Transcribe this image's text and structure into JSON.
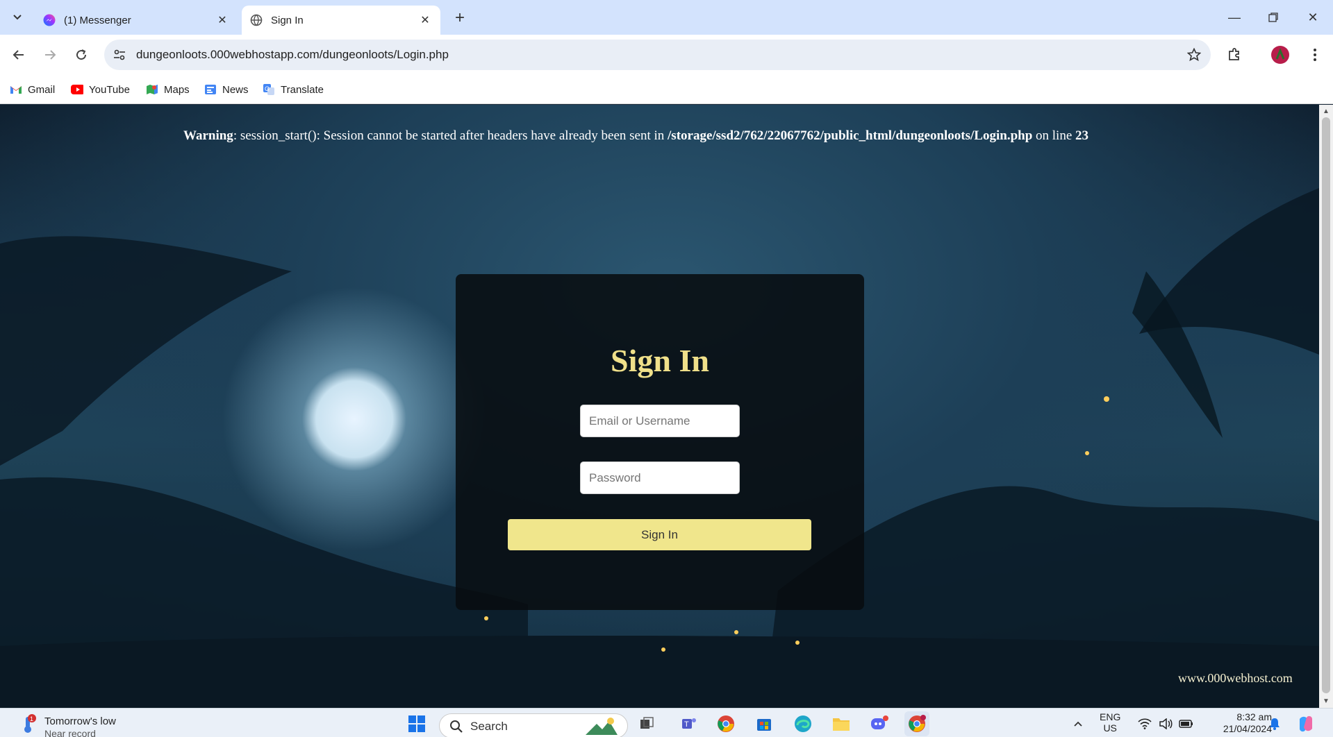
{
  "browser": {
    "tabs": [
      {
        "title": "(1) Messenger",
        "icon": "messenger-icon"
      },
      {
        "title": "Sign In",
        "icon": "globe-icon"
      }
    ],
    "url": "dungeonloots.000webhostapp.com/dungeonloots/Login.php"
  },
  "bookmarks": [
    {
      "label": "Gmail",
      "icon": "gmail-icon"
    },
    {
      "label": "YouTube",
      "icon": "youtube-icon"
    },
    {
      "label": "Maps",
      "icon": "maps-icon"
    },
    {
      "label": "News",
      "icon": "news-icon"
    },
    {
      "label": "Translate",
      "icon": "translate-icon"
    }
  ],
  "page": {
    "warning": {
      "prefix": "Warning",
      "message": ": session_start(): Session cannot be started after headers have already been sent in ",
      "path": "/storage/ssd2/762/22067762/public_html/dungeonloots/Login.php",
      "on_line": " on line ",
      "line": "23"
    },
    "login": {
      "title": "Sign In",
      "email_placeholder": "Email or Username",
      "password_placeholder": "Password",
      "button": "Sign In"
    },
    "watermark": "www.000webhost.com"
  },
  "taskbar": {
    "weather_title": "Tomorrow's low",
    "weather_sub": "Near record",
    "weather_badge": "1",
    "search": "Search",
    "lang": "ENG",
    "region": "US",
    "time": "8:32 am",
    "date": "21/04/2024"
  },
  "colors": {
    "title": "#f0e08a",
    "button": "#f0e68c",
    "tabbar": "#d3e3fd"
  }
}
